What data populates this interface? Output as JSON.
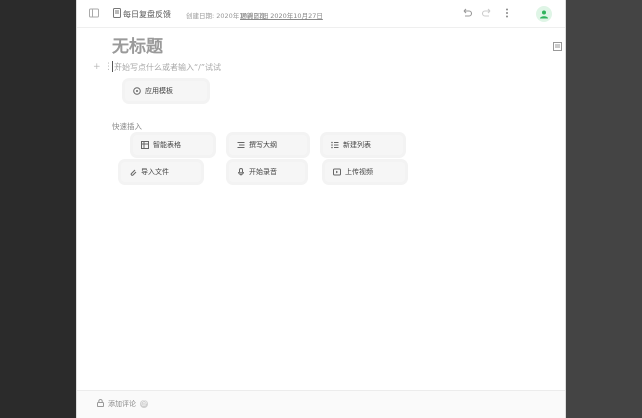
{
  "header": {
    "doc_title": "每日复盘反馈",
    "created": "创建日期: 2020年10月27日",
    "updated": "更新日期: 2020年10月27日"
  },
  "editor": {
    "title": "无标题",
    "placeholder": "开始写点什么或者输入“/”试试"
  },
  "template_button": {
    "label": "应用模板",
    "icon": "template-icon"
  },
  "quick_insert": {
    "label": "快速插入",
    "items": [
      {
        "label": "智能表格",
        "icon": "table-icon"
      },
      {
        "label": "撰写大纲",
        "icon": "outline-icon"
      },
      {
        "label": "新建列表",
        "icon": "list-icon"
      },
      {
        "label": "导入文件",
        "icon": "attach-icon"
      },
      {
        "label": "开始录音",
        "icon": "mic-icon"
      },
      {
        "label": "上传视频",
        "icon": "video-icon"
      }
    ]
  },
  "footer": {
    "add_comment": "添加评论"
  },
  "colors": {
    "accent": "#2fb35c",
    "avatar_bg": "#dff5e6"
  }
}
